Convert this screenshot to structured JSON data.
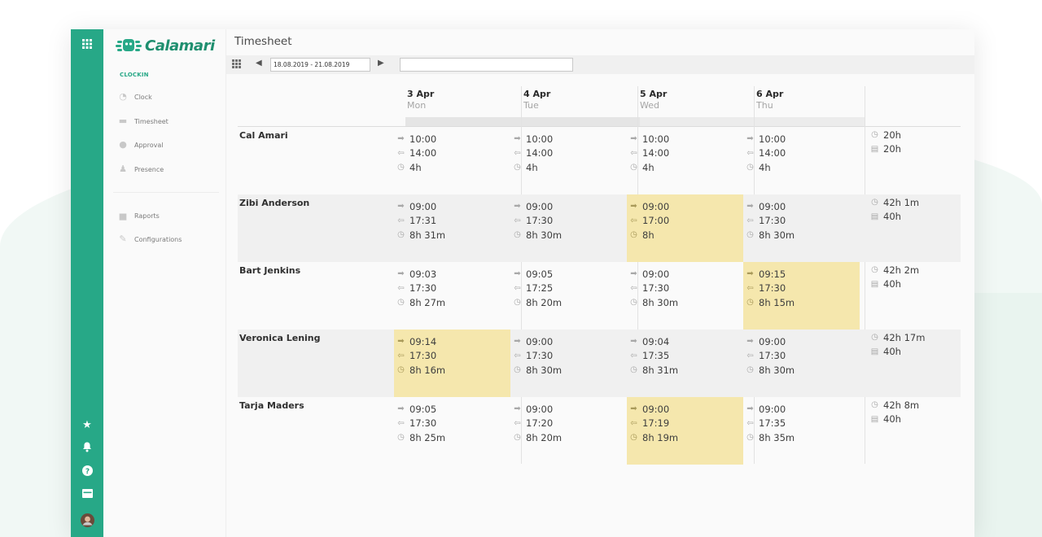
{
  "app": {
    "name": "Calamari",
    "section_label": "CLOCKIN"
  },
  "colors": {
    "brand": "#27a887",
    "highlight": "#f5e7ad"
  },
  "sidebar": {
    "items": [
      {
        "label": "Clock",
        "icon": "clock-icon"
      },
      {
        "label": "Timesheet",
        "icon": "timesheet-icon"
      },
      {
        "label": "Approval",
        "icon": "check-circle-icon"
      },
      {
        "label": "Presence",
        "icon": "person-icon"
      },
      {
        "label": "Raports",
        "icon": "chart-icon"
      },
      {
        "label": "Configurations",
        "icon": "wrench-icon"
      }
    ]
  },
  "rail": {
    "icons": [
      "apps-grid-icon",
      "star-icon",
      "bell-icon",
      "help-icon",
      "inbox-icon",
      "avatar"
    ]
  },
  "page": {
    "title": "Timesheet"
  },
  "toolbar": {
    "date_range": "18.08.2019 - 21.08.2019",
    "search_value": ""
  },
  "days": [
    {
      "date": "3 Apr",
      "weekday": "Mon"
    },
    {
      "date": "4 Apr",
      "weekday": "Tue"
    },
    {
      "date": "5 Apr",
      "weekday": "Wed"
    },
    {
      "date": "6 Apr",
      "weekday": "Thu"
    }
  ],
  "rows": [
    {
      "name": "Cal Amari",
      "cells": [
        {
          "in": "10:00",
          "out": "14:00",
          "dur": "4h",
          "hl": false
        },
        {
          "in": "10:00",
          "out": "14:00",
          "dur": "4h",
          "hl": false
        },
        {
          "in": "10:00",
          "out": "14:00",
          "dur": "4h",
          "hl": false
        },
        {
          "in": "10:00",
          "out": "14:00",
          "dur": "4h",
          "hl": false
        }
      ],
      "total": "20h",
      "expected": "20h"
    },
    {
      "name": "Zibi Anderson",
      "cells": [
        {
          "in": "09:00",
          "out": "17:31",
          "dur": "8h 31m",
          "hl": false
        },
        {
          "in": "09:00",
          "out": "17:30",
          "dur": "8h 30m",
          "hl": false
        },
        {
          "in": "09:00",
          "out": "17:00",
          "dur": "8h",
          "hl": true
        },
        {
          "in": "09:00",
          "out": "17:30",
          "dur": "8h 30m",
          "hl": false
        }
      ],
      "total": "42h 1m",
      "expected": "40h"
    },
    {
      "name": "Bart Jenkins",
      "cells": [
        {
          "in": "09:03",
          "out": "17:30",
          "dur": "8h 27m",
          "hl": false
        },
        {
          "in": "09:05",
          "out": "17:25",
          "dur": "8h 20m",
          "hl": false
        },
        {
          "in": "09:00",
          "out": "17:30",
          "dur": "8h 30m",
          "hl": false
        },
        {
          "in": "09:15",
          "out": "17:30",
          "dur": "8h 15m",
          "hl": true
        }
      ],
      "total": "42h 2m",
      "expected": "40h"
    },
    {
      "name": "Veronica Lening",
      "cells": [
        {
          "in": "09:14",
          "out": "17:30",
          "dur": "8h 16m",
          "hl": true
        },
        {
          "in": "09:00",
          "out": "17:30",
          "dur": "8h 30m",
          "hl": false
        },
        {
          "in": "09:04",
          "out": "17:35",
          "dur": "8h 31m",
          "hl": false
        },
        {
          "in": "09:00",
          "out": "17:30",
          "dur": "8h 30m",
          "hl": false
        }
      ],
      "total": "42h 17m",
      "expected": "40h"
    },
    {
      "name": "Tarja Maders",
      "cells": [
        {
          "in": "09:05",
          "out": "17:30",
          "dur": "8h 25m",
          "hl": false
        },
        {
          "in": "09:00",
          "out": "17:20",
          "dur": "8h 20m",
          "hl": false
        },
        {
          "in": "09:00",
          "out": "17:19",
          "dur": "8h 19m",
          "hl": true
        },
        {
          "in": "09:00",
          "out": "17:35",
          "dur": "8h 35m",
          "hl": false
        }
      ],
      "total": "42h 8m",
      "expected": "40h"
    }
  ]
}
